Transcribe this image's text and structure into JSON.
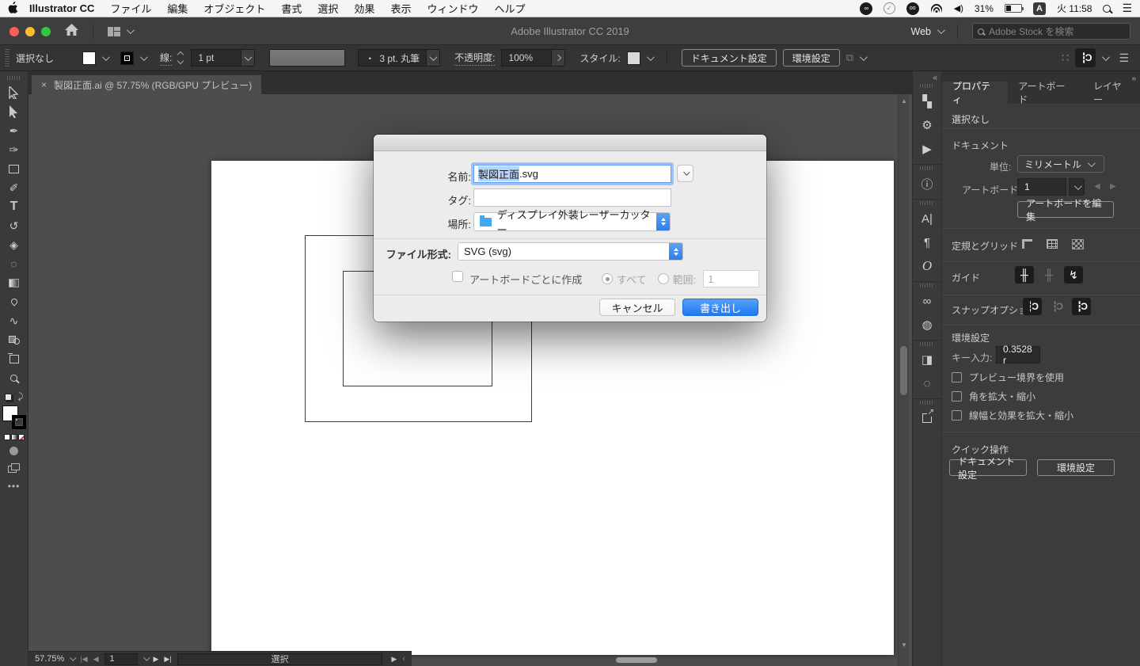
{
  "menubar": {
    "app_name": "Illustrator CC",
    "items": [
      "ファイル",
      "編集",
      "オブジェクト",
      "書式",
      "選択",
      "効果",
      "表示",
      "ウィンドウ",
      "ヘルプ"
    ],
    "battery_pct": "31%",
    "input_source": "A",
    "clock": "火 11:58"
  },
  "titlebar": {
    "title": "Adobe Illustrator CC 2019",
    "workspace": "Web",
    "search_placeholder": "Adobe Stock を検索"
  },
  "controlbar": {
    "selection_status": "選択なし",
    "stroke_label": "線:",
    "stroke_width": "1 pt",
    "brush_bullet": "・",
    "brush_value": "3 pt. 丸筆",
    "opacity_label": "不透明度:",
    "opacity_value": "100%",
    "style_label": "スタイル:",
    "doc_setup_btn": "ドキュメント設定",
    "prefs_btn": "環境設定"
  },
  "document_tab": {
    "close": "×",
    "title": "製図正面.ai @ 57.75% (RGB/GPU プレビュー)"
  },
  "dialog": {
    "name_label": "名前:",
    "name_selected": "製図正面",
    "name_rest": ".svg",
    "tags_label": "タグ:",
    "location_label": "場所:",
    "location_value": "ディスプレイ外装レーザーカッター",
    "format_label": "ファイル形式:",
    "format_value": "SVG (svg)",
    "artboard_checkbox_label": "アートボードごとに作成",
    "radio_all_label": "すべて",
    "radio_range_label": "範囲:",
    "range_value": "1",
    "cancel_btn": "キャンセル",
    "export_btn": "書き出し"
  },
  "props": {
    "tabs": [
      "プロパティ",
      "アートボード",
      "レイヤー"
    ],
    "selection_status": "選択なし",
    "document_title": "ドキュメント",
    "unit_label": "単位:",
    "unit_value": "ミリメートル",
    "artboard_label": "アートボード:",
    "artboard_value": "1",
    "edit_artboards_btn": "アートボードを編集",
    "rulers_title": "定規とグリッド",
    "guides_title": "ガイド",
    "snap_title": "スナップオプション",
    "prefs_title": "環境設定",
    "key_label": "キー入力:",
    "key_value": "0.3528 r",
    "check1": "プレビュー境界を使用",
    "check2": "角を拡大・縮小",
    "check3": "線幅と効果を拡大・縮小",
    "quick_title": "クイック操作",
    "quick_doc_btn": "ドキュメント設定",
    "quick_prefs_btn": "環境設定"
  },
  "statusbar": {
    "zoom": "57.75%",
    "artboard_nav_value": "1",
    "status_display": "選択"
  }
}
